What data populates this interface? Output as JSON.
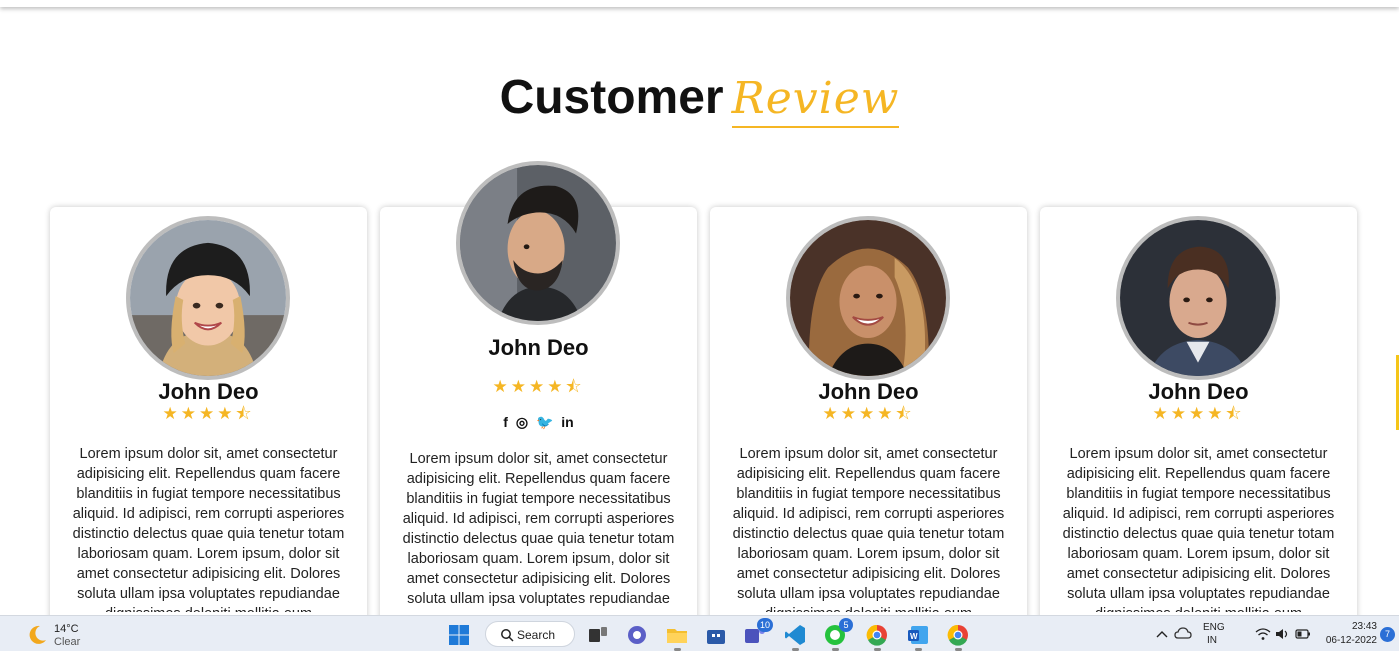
{
  "heading": {
    "main": "Customer",
    "accent": "Review"
  },
  "colors": {
    "accent": "#f5b624",
    "text": "#111111",
    "card_border": "#bdbdbd",
    "taskbar": "#e8edf5"
  },
  "cards": [
    {
      "name": "John Deo",
      "stars": "★★★★⯪",
      "rating": 4.5,
      "review": "Lorem ipsum dolor sit, amet consectetur adipisicing elit. Repellendus quam facere blanditiis in fugiat tempore necessitatibus aliquid. Id adipisci, rem corrupti asperiores distinctio delectus quae quia tenetur totam laboriosam quam. Lorem ipsum, dolor sit amet consectetur adipisicing elit. Dolores soluta ullam ipsa voluptates repudiandae dignissimos deleniti mollitia eum"
    },
    {
      "name": "John Deo",
      "stars": "★★★★⯪",
      "rating": 4.5,
      "social": {
        "facebook": "f",
        "instagram": "◎",
        "twitter": "🐦",
        "linkedin": "in"
      },
      "review": "Lorem ipsum dolor sit, amet consectetur adipisicing elit. Repellendus quam facere blanditiis in fugiat tempore necessitatibus aliquid. Id adipisci, rem corrupti asperiores distinctio delectus quae quia tenetur totam laboriosam quam. Lorem ipsum, dolor sit amet consectetur adipisicing elit. Dolores soluta ullam ipsa voluptates repudiandae dignissimos deleniti mollitia eum"
    },
    {
      "name": "John Deo",
      "stars": "★★★★⯪",
      "rating": 4.5,
      "review": "Lorem ipsum dolor sit, amet consectetur adipisicing elit. Repellendus quam facere blanditiis in fugiat tempore necessitatibus aliquid. Id adipisci, rem corrupti asperiores distinctio delectus quae quia tenetur totam laboriosam quam. Lorem ipsum, dolor sit amet consectetur adipisicing elit. Dolores soluta ullam ipsa voluptates repudiandae dignissimos deleniti mollitia eum"
    },
    {
      "name": "John Deo",
      "stars": "★★★★⯪",
      "rating": 4.5,
      "review": "Lorem ipsum dolor sit, amet consectetur adipisicing elit. Repellendus quam facere blanditiis in fugiat tempore necessitatibus aliquid. Id adipisci, rem corrupti asperiores distinctio delectus quae quia tenetur totam laboriosam quam. Lorem ipsum, dolor sit amet consectetur adipisicing elit. Dolores soluta ullam ipsa voluptates repudiandae dignissimos deleniti mollitia eum"
    }
  ],
  "taskbar": {
    "weather": {
      "temp": "14°C",
      "condition": "Clear",
      "icon": "moon-icon"
    },
    "search_label": "Search",
    "apps": [
      {
        "icon": "windows-start-icon"
      },
      {
        "icon": "task-view-icon"
      },
      {
        "icon": "chat-icon"
      },
      {
        "icon": "file-explorer-icon"
      },
      {
        "icon": "store-icon"
      },
      {
        "icon": "teams-icon",
        "badge": "10"
      },
      {
        "icon": "vscode-icon"
      },
      {
        "icon": "whatsapp-icon",
        "badge": "5"
      },
      {
        "icon": "chrome-icon"
      },
      {
        "icon": "word-icon"
      },
      {
        "icon": "chrome-icon"
      }
    ],
    "tray": {
      "lang_top": "ENG",
      "lang_bottom": "IN",
      "time": "23:43",
      "date": "06-12-2022",
      "notifications": "7"
    }
  }
}
